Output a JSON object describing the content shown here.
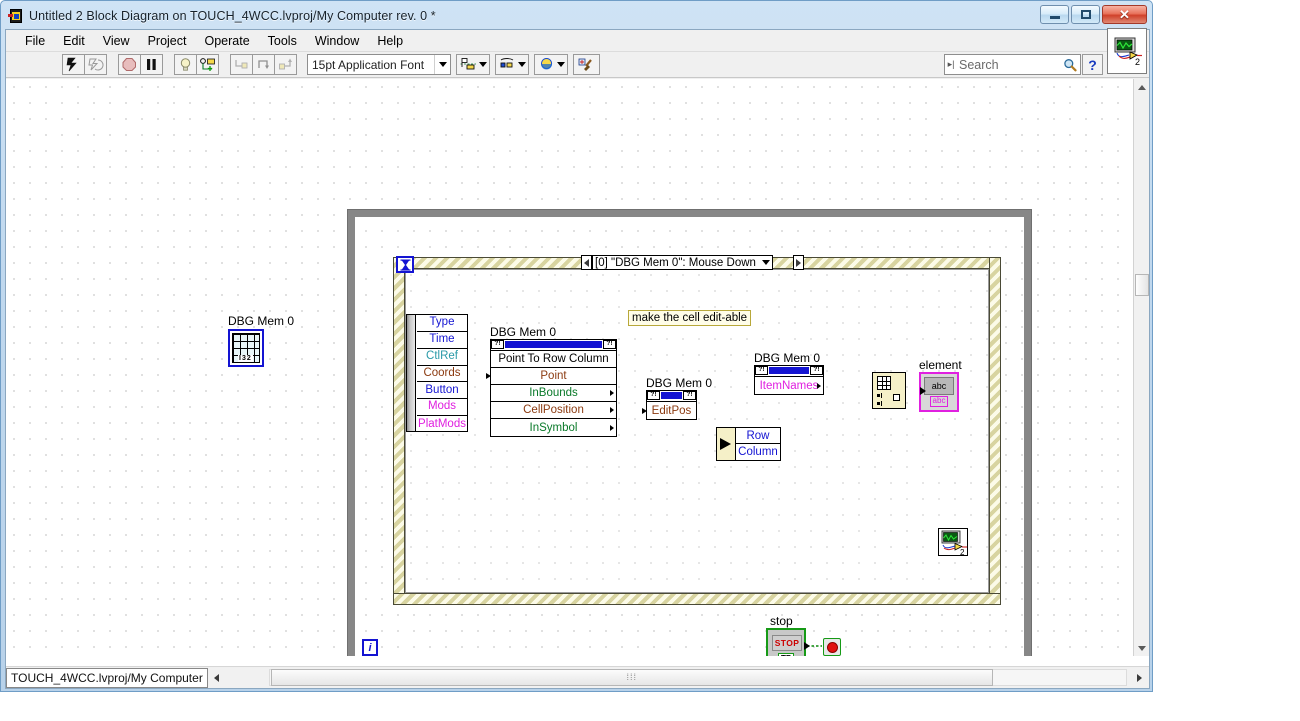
{
  "window": {
    "title": "Untitled 2 Block Diagram on TOUCH_4WCC.lvproj/My Computer rev. 0 *",
    "icon": "labview-block-diagram-icon",
    "minimize": "minimize-icon",
    "maximize": "maximize-icon",
    "close": "close-icon"
  },
  "menubar": {
    "items": [
      {
        "label": "File"
      },
      {
        "label": "Edit"
      },
      {
        "label": "View"
      },
      {
        "label": "Project"
      },
      {
        "label": "Operate"
      },
      {
        "label": "Tools"
      },
      {
        "label": "Window"
      },
      {
        "label": "Help"
      }
    ]
  },
  "toolbar": {
    "run": "run-arrow-icon",
    "run_continuously": "run-continuously-icon",
    "abort": "abort-execution-icon",
    "pause": "pause-icon",
    "highlight": "highlight-execution-lightbulb-icon",
    "retain_wire_values": "retain-wire-values-icon",
    "step_into": "step-into-icon",
    "step_over": "step-over-icon",
    "step_out": "step-out-icon",
    "font": "15pt Application Font",
    "font_dropdown": "chevron-down-icon",
    "align_objects": "align-objects-icon",
    "distribute_objects": "distribute-objects-icon",
    "reorder": "reorder-icon",
    "clean_up_diagram": "clean-up-diagram-icon",
    "search_placeholder": "Search",
    "search_icon": "magnifier-icon",
    "help_label": "?",
    "vi_icon": "vi-connector-pane-icon",
    "vi_icon_number": "2"
  },
  "statusbar": {
    "path": "TOUCH_4WCC.lvproj/My Computer",
    "scroll_left": "scroll-left-icon",
    "scroll_right": "scroll-right-icon",
    "grip": "⁞⁞⁞"
  },
  "diagram": {
    "while_loop": {
      "name": "while-loop"
    },
    "iteration_terminal": {
      "label": "i"
    },
    "event_structure": {
      "timeout_icon": "hourglass-icon",
      "selector_label": "[0] \"DBG Mem 0\": Mouse Down",
      "selector_left_arrow": "left-arrow-icon",
      "selector_right_arrow": "right-arrow-icon",
      "selector_dropdown": "chevron-down-icon"
    },
    "event_data_node": {
      "name": "event-data-node",
      "rows": [
        {
          "label": "Type",
          "color": "#1414d2"
        },
        {
          "label": "Time",
          "color": "#1414d2"
        },
        {
          "label": "CtlRef",
          "color": "#2a9aa8"
        },
        {
          "label": "Coords",
          "color": "#8b3a10"
        },
        {
          "label": "Button",
          "color": "#1414d2"
        },
        {
          "label": "Mods",
          "color": "#e020e0"
        },
        {
          "label": "PlatMods",
          "color": "#e020e0"
        }
      ]
    },
    "terminals": [
      {
        "name": "dbg-mem-0-array-terminal",
        "label": "DBG Mem 0",
        "datatype": "I32"
      }
    ],
    "property_nodes": [
      {
        "name": "point-to-row-column-invoke-node",
        "label": "DBG Mem 0",
        "ref_glyph": "?!",
        "method": "Point To Row Column",
        "rows": [
          {
            "label": "Point",
            "color": "#8b3a10",
            "input": true,
            "output": false
          },
          {
            "label": "InBounds",
            "color": "#0a7a2a",
            "input": false,
            "output": true
          },
          {
            "label": "CellPosition",
            "color": "#8b3a10",
            "input": false,
            "output": true
          },
          {
            "label": "InSymbol",
            "color": "#0a7a2a",
            "input": false,
            "output": true
          }
        ]
      },
      {
        "name": "edit-pos-property-node",
        "label": "DBG Mem 0",
        "ref_glyph": "?!",
        "rows": [
          {
            "label": "EditPos",
            "color": "#8b3a10",
            "input": true,
            "output": false
          }
        ]
      },
      {
        "name": "item-names-property-node",
        "label": "DBG Mem 0",
        "ref_glyph": "?!",
        "rows": [
          {
            "label": "ItemNames",
            "color": "#e020e0",
            "input": false,
            "output": true
          }
        ]
      }
    ],
    "unbundle_node": {
      "name": "unbundle-by-name",
      "rows": [
        {
          "label": "Row",
          "color": "#1414d2"
        },
        {
          "label": "Column",
          "color": "#1414d2"
        }
      ]
    },
    "index_array": {
      "name": "index-array-function"
    },
    "element_indicator": {
      "name": "element-string-indicator",
      "label": "element",
      "inner_glyph": "abc",
      "type_glyph": "abc"
    },
    "stop_control": {
      "name": "stop-boolean-control",
      "label": "stop",
      "button_text": "STOP",
      "datatype": "TF"
    },
    "loop_condition": {
      "name": "loop-conditional-terminal",
      "glyph": "stop-sign-icon"
    },
    "subvi": {
      "name": "subvi-icon",
      "number": "2"
    },
    "comment": {
      "text": "make the cell edit-able"
    }
  },
  "colors": {
    "wire_refnum": "#8b3a10",
    "wire_cluster": "#8b3a10",
    "wire_i32": "#1414d2",
    "wire_string_array": "#e020e0",
    "wire_boolean": "#0a8a0a",
    "loop_border": "#878787",
    "event_border": "#d8d4a0"
  }
}
